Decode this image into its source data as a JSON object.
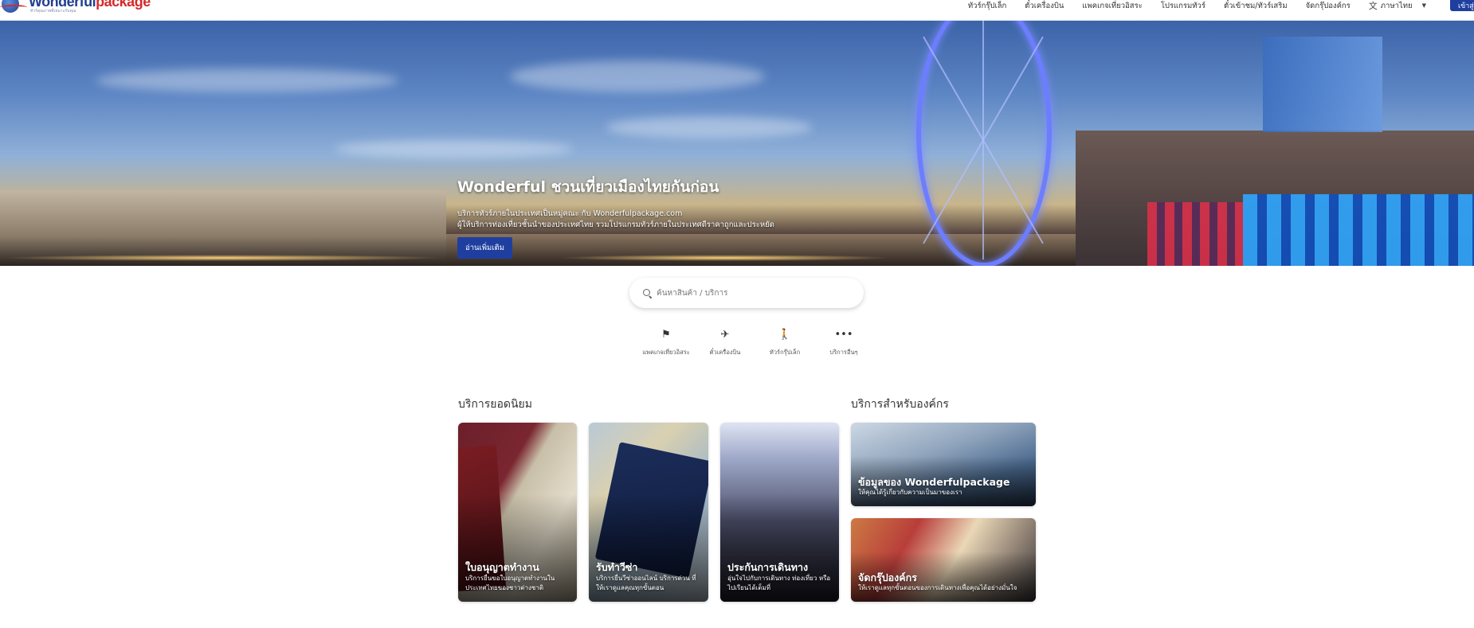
{
  "header": {
    "logo_text_a": "Wonderful",
    "logo_text_b": "package",
    "logo_tag": "ทัวร์คุณภาพที่เหมาะกับคุณ",
    "nav": [
      {
        "label": "ทัวร์กรุ๊ปเล็ก"
      },
      {
        "label": "ตั๋วเครื่องบิน"
      },
      {
        "label": "แพคเกจเที่ยวอิสระ"
      },
      {
        "label": "โปรแกรมทัวร์"
      },
      {
        "label": "ตั๋วเข้าชม/ทัวร์เสริม"
      },
      {
        "label": "จัดกรุ๊ปองค์กร"
      }
    ],
    "language": "ภาษาไทย",
    "login_label": "เข้าสู่ระบบ"
  },
  "hero": {
    "title": "Wonderful ชวนเที่ยวเมืองไทยกันก่อน",
    "subtitle_line1": "บริการทัวร์ภายในประเทศเป็นหมู่คณะ กับ Wonderfulpackage.com",
    "subtitle_line2": "ผู้ให้บริการท่องเที่ยวชั้นนำของประเทศไทย รวมโปรแกรมทัวร์ภายในประเทศดีราคาถูกและประหยัด",
    "button": "อ่านเพิ่มเติม"
  },
  "search": {
    "placeholder": "ค้นหาสินค้า / บริการ"
  },
  "quick": [
    {
      "icon": "flag-icon",
      "label": "แพคเกจเที่ยวอิสระ"
    },
    {
      "icon": "airplane-icon",
      "label": "ตั๋วเครื่องบิน"
    },
    {
      "icon": "hiker-icon",
      "label": "ทัวร์กรุ๊ปเล็ก"
    },
    {
      "icon": "more-icon",
      "label": "บริการอื่นๆ"
    }
  ],
  "popular": {
    "title": "บริการยอดนิยม",
    "cards": [
      {
        "title": "ใบอนุญาตทำงาน",
        "desc": "บริการยื่นขอใบอนุญาตทำงานในประเทศไทยของชาวต่างชาติ"
      },
      {
        "title": "รับทำวีซ่า",
        "desc": "บริการยื่นวีซ่าออนไลน์ บริการด่วน ที่ให้เราดูแลคุณทุกขั้นตอน"
      },
      {
        "title": "ประกันการเดินทาง",
        "desc": "อุ่นใจไปกับการเดินทาง ท่องเที่ยว หรือไปเรียนได้เต็มที่"
      }
    ]
  },
  "corporate": {
    "title": "บริการสำหรับองค์กร",
    "cards": [
      {
        "title": "ข้อมูลของ Wonderfulpackage",
        "desc": "ให้คุณได้รู้เกี่ยวกับความเป็นมาของเรา"
      },
      {
        "title": "จัดกรุ๊ปองค์กร",
        "desc": "ให้เราดูแลทุกขั้นตอนของการเดินทางเพื่อคุณได้อย่างมั่นใจ"
      }
    ]
  },
  "colors": {
    "brand_blue": "#1f3fa0",
    "brand_red": "#d62a2a"
  }
}
